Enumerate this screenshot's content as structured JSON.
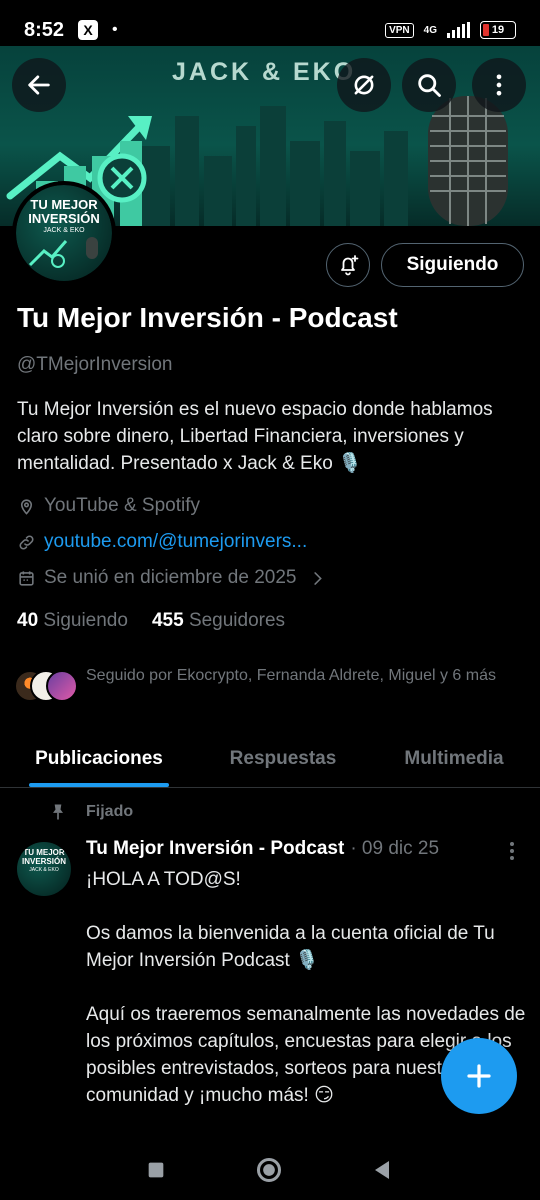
{
  "status_bar": {
    "time": "8:52",
    "app_icon": "X",
    "dot": "•",
    "vpn": "VPN",
    "network": "4G",
    "battery": "19",
    "battery_level": 0.19
  },
  "header": {
    "banner_text": "JACK & EKO",
    "back_icon": "arrow-left-icon",
    "grok_icon": "slash-circle-icon",
    "search_icon": "search-icon",
    "more_icon": "more-vertical-icon"
  },
  "avatar": {
    "line1": "TU MEJOR",
    "line2": "INVERSIÓN",
    "line3": "JACK & EKO"
  },
  "actions": {
    "notify_icon": "bell-plus-icon",
    "follow_label": "Siguiendo"
  },
  "profile": {
    "name": "Tu Mejor Inversión - Podcast",
    "handle": "@TMejorInversion",
    "bio": "Tu Mejor Inversión es el nuevo espacio donde hablamos claro sobre dinero, Libertad Financiera, inversiones y mentalidad. Presentado x Jack & Eko 🎙️",
    "location": "YouTube & Spotify",
    "link": "youtube.com/@tumejorinvers...",
    "joined": "Se unió en diciembre de 2025",
    "following_count": "40",
    "following_label": "Siguiendo",
    "followers_count": "455",
    "followers_label": "Seguidores",
    "followed_by": "Seguido por Ekocrypto, Fernanda Aldrete, Miguel y 6 más"
  },
  "tabs": [
    "Publicaciones",
    "Respuestas",
    "Multimedia"
  ],
  "post": {
    "pinned_label": "Fijado",
    "author": "Tu Mejor Inversión - Podcast",
    "date": "· 09 dic 25",
    "paragraph1": "¡HOLA A TOD@S!",
    "paragraph2": "Os damos la bienvenida a la cuenta oficial de Tu Mejor Inversión Podcast 🎙️",
    "paragraph3": "Aquí os traeremos semanalmente las novedades de los próximos capítulos, encuestas para elegir a los posibles entrevistados, sorteos para nuestra comunidad y ¡mucho más! 😏"
  },
  "colors": {
    "accent": "#1d9bf0",
    "muted": "#71767b",
    "banner": "#0a544a",
    "background": "#000000"
  }
}
